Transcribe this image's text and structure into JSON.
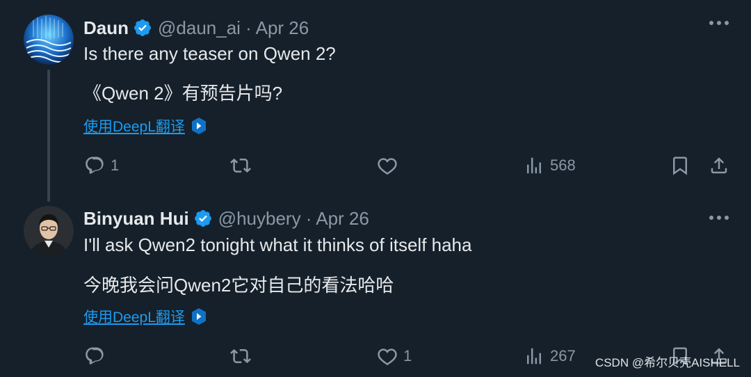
{
  "tweets": [
    {
      "author": "Daun",
      "handle_date": "@daun_ai · Apr 26",
      "text_en": "Is there any teaser on Qwen 2?",
      "text_zh": "《Qwen 2》有预告片吗?",
      "translate_label": "使用DeepL翻译",
      "reply_count": "1",
      "retweet_count": "",
      "like_count": "",
      "views_count": "568"
    },
    {
      "author": "Binyuan Hui",
      "handle_date": "@huybery · Apr 26",
      "text_en": "I'll ask Qwen2 tonight what it thinks of itself haha",
      "text_zh": "今晚我会问Qwen2它对自己的看法哈哈",
      "translate_label": "使用DeepL翻译",
      "reply_count": "",
      "retweet_count": "",
      "like_count": "1",
      "views_count": "267"
    }
  ],
  "watermark": "CSDN @希尔贝壳AISHELL",
  "colors": {
    "background": "#15202b",
    "text": "#e7e9ea",
    "muted": "#8b98a5",
    "link": "#1d9bf0",
    "verified": "#1d9bf0"
  },
  "icons": [
    "verified-badge-icon",
    "more-icon",
    "deepl-icon",
    "reply-icon",
    "retweet-icon",
    "like-icon",
    "views-icon",
    "bookmark-icon",
    "share-icon"
  ]
}
